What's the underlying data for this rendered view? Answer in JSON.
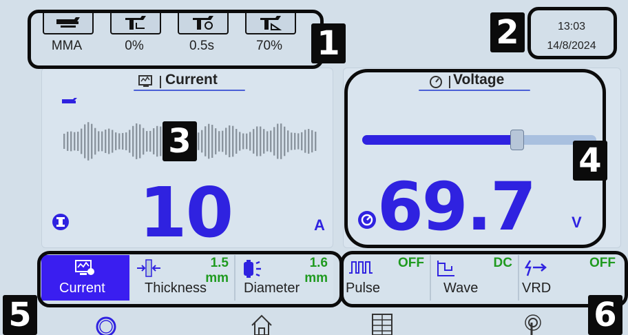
{
  "top_bar": {
    "items": [
      {
        "icon": "welding-torch-icon",
        "label": "MMA"
      },
      {
        "icon": "torch-arc-force-icon",
        "label": "0%"
      },
      {
        "icon": "torch-hot-start-time-icon",
        "label": "0.5s"
      },
      {
        "icon": "torch-hot-start-icon",
        "label": "70%"
      }
    ]
  },
  "clock": {
    "time": "13:03",
    "date": "14/8/2024"
  },
  "current_panel": {
    "title": "Current",
    "value": "10",
    "unit": "A"
  },
  "voltage_panel": {
    "title": "Voltage",
    "value": "69.7",
    "unit": "V",
    "slider_level_fraction": 0.66
  },
  "param_tabs": [
    {
      "label": "Current",
      "value": "",
      "unit": "",
      "icon": "monitor-info-icon",
      "active": true
    },
    {
      "label": "Thickness",
      "value": "1.5",
      "unit": "mm",
      "icon": "thickness-icon",
      "active": false
    },
    {
      "label": "Diameter",
      "value": "1.6",
      "unit": "mm",
      "icon": "electrode-diameter-icon",
      "active": false
    }
  ],
  "func_tabs": [
    {
      "label": "Pulse",
      "value": "OFF",
      "icon": "pulse-wave-icon"
    },
    {
      "label": "Wave",
      "value": "DC",
      "icon": "waveform-icon"
    },
    {
      "label": "VRD",
      "value": "OFF",
      "icon": "vrd-icon"
    }
  ],
  "bottom_nav": [
    "gauge-icon",
    "home-icon",
    "menu-grid-icon",
    "touch-icon"
  ],
  "callouts": [
    "1",
    "2",
    "3",
    "4",
    "5",
    "6"
  ],
  "colors": {
    "background": "#d3dfe9",
    "accent_blue": "#2f22e0",
    "active_tab": "#3a1ef0",
    "status_green": "#1f9a1f"
  }
}
